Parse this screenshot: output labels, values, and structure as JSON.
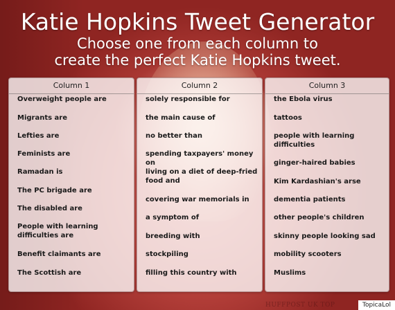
{
  "header": {
    "title": "Katie Hopkins Tweet Generator",
    "subtitle_line1": "Choose one from each column to",
    "subtitle_line2": "create the perfect Katie Hopkins tweet."
  },
  "columns": [
    {
      "heading": "Column 1",
      "items": [
        "Overweight people are",
        "Migrants are",
        "Lefties are",
        "Feminists are",
        "Ramadan is",
        "The PC brigade are",
        "The disabled are",
        "People with learning difficulties are",
        "Benefit claimants are",
        "The Scottish are"
      ]
    },
    {
      "heading": "Column 2",
      "items": [
        "solely responsible for",
        "the main cause of",
        "no better than",
        "spending taxpayers' money on",
        "living on a diet of deep-fried food and",
        "covering war memorials in",
        "a symptom of",
        "breeding with",
        "stockpiling",
        "filling this country with"
      ]
    },
    {
      "heading": "Column 3",
      "items": [
        "the Ebola virus",
        "tattoos",
        "people with learning difficulties",
        "ginger-haired babies",
        "Kim Kardashian's arse",
        "dementia patients",
        "other people's children",
        "skinny people looking sad",
        "mobility scooters",
        "Muslims"
      ]
    }
  ],
  "footer": {
    "watermark": "HUFFPOST UK TOP",
    "brand": "TopicaLol"
  }
}
